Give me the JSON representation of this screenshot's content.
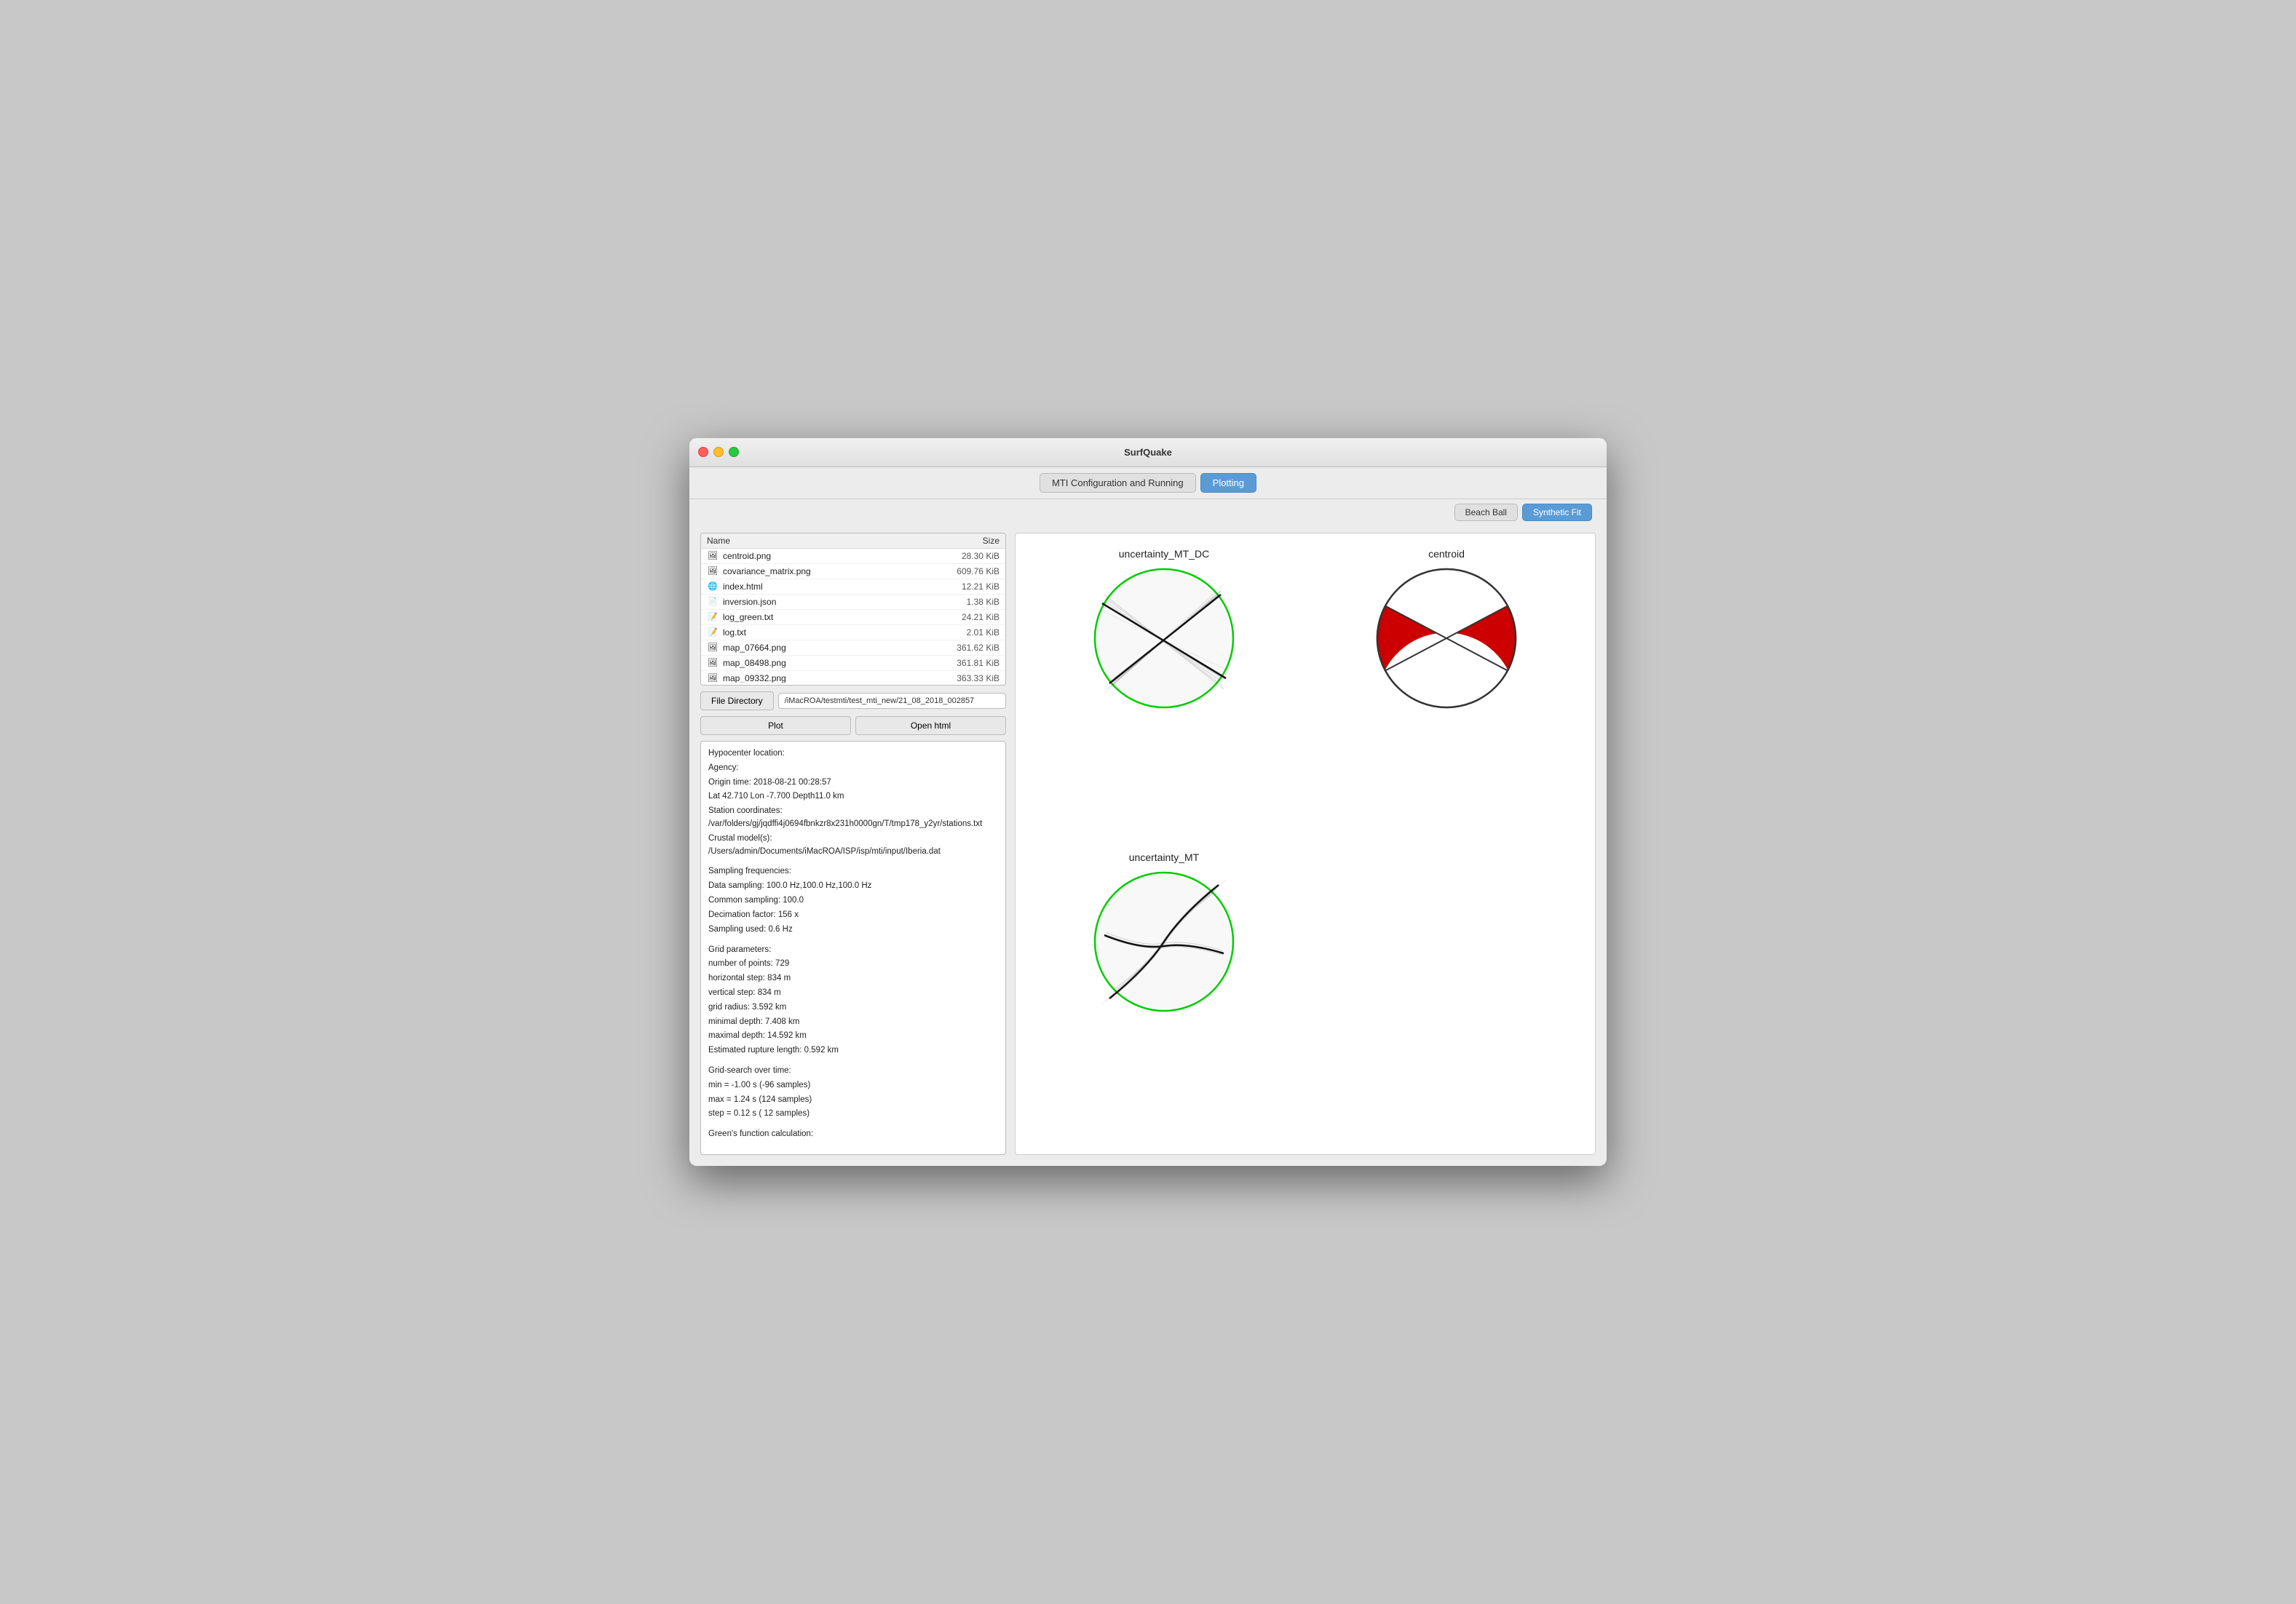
{
  "window": {
    "title": "SurfQuake"
  },
  "toolbar": {
    "tabs": [
      {
        "id": "mti",
        "label": "MTI Configuration and Running",
        "active": false
      },
      {
        "id": "plotting",
        "label": "Plotting",
        "active": true
      }
    ]
  },
  "subtoolbar": {
    "buttons": [
      {
        "id": "beachball",
        "label": "Beach Ball",
        "active": false
      },
      {
        "id": "syntheticfit",
        "label": "Synthetic Fit",
        "active": true
      }
    ]
  },
  "file_list": {
    "headers": {
      "name": "Name",
      "size": "Size"
    },
    "files": [
      {
        "icon": "png",
        "name": "centroid.png",
        "size": "28.30 KiB"
      },
      {
        "icon": "png",
        "name": "covariance_matrix.png",
        "size": "609.76 KiB"
      },
      {
        "icon": "html",
        "name": "index.html",
        "size": "12.21 KiB"
      },
      {
        "icon": "json",
        "name": "inversion.json",
        "size": "1.38 KiB"
      },
      {
        "icon": "txt",
        "name": "log_green.txt",
        "size": "24.21 KiB"
      },
      {
        "icon": "txt",
        "name": "log.txt",
        "size": "2.01 KiB"
      },
      {
        "icon": "png",
        "name": "map_07664.png",
        "size": "361.62 KiB"
      },
      {
        "icon": "png",
        "name": "map_08498.png",
        "size": "361.81 KiB"
      },
      {
        "icon": "png",
        "name": "map_09332.png",
        "size": "363.33 KiB"
      }
    ]
  },
  "controls": {
    "file_directory_label": "File Directory",
    "dir_path": "/iMacROA/testmti/test_mti_new/21_08_2018_002857",
    "plot_label": "Plot",
    "open_html_label": "Open html"
  },
  "info": {
    "hypocenter_section": {
      "title": "Hypocenter location:",
      "lines": [
        " Agency:",
        " Origin time: 2018-08-21 00:28:57",
        " Lat  42.710   Lon  -7.700   Depth11.0 km",
        "Station coordinates: /var/folders/gj/jqdffi4j0694fbnkzr8x231h0000gn/T/tmp178_y2yr/stations.txt",
        "Crustal model(s): /Users/admin/Documents/iMacROA/ISP/isp/mti/input/Iberia.dat"
      ]
    },
    "sampling_section": {
      "title": "Sampling frequencies:",
      "lines": [
        " Data sampling: 100.0 Hz,100.0 Hz,100.0 Hz",
        " Common sampling: 100.0",
        " Decimation factor: 156 x",
        " Sampling used:   0.6 Hz"
      ]
    },
    "grid_section": {
      "title": "Grid parameters:",
      "lines": [
        " number of points:  729",
        " horizontal step:   834 m",
        " vertical step:   834 m",
        " grid radius:  3.592 km",
        " minimal depth:  7.408 km",
        " maximal depth: 14.592 km",
        "Estimated rupture length:  0.592 km"
      ]
    },
    "grid_search_section": {
      "title": "Grid-search over time:",
      "lines": [
        " min = -1.00 s (-96 samples)",
        " max =  1.24 s (124 samples)",
        " step = 0.12 s ( 12 samples)"
      ]
    },
    "greens_section": {
      "title": "Green's function calculation:"
    }
  },
  "plots": [
    {
      "id": "uncertainty_mt_dc",
      "title": "uncertainty_MT_DC",
      "type": "uncertainty_mt_dc"
    },
    {
      "id": "centroid",
      "title": "centroid",
      "type": "centroid"
    },
    {
      "id": "uncertainty_mt",
      "title": "uncertainty_MT",
      "type": "uncertainty_mt"
    }
  ]
}
